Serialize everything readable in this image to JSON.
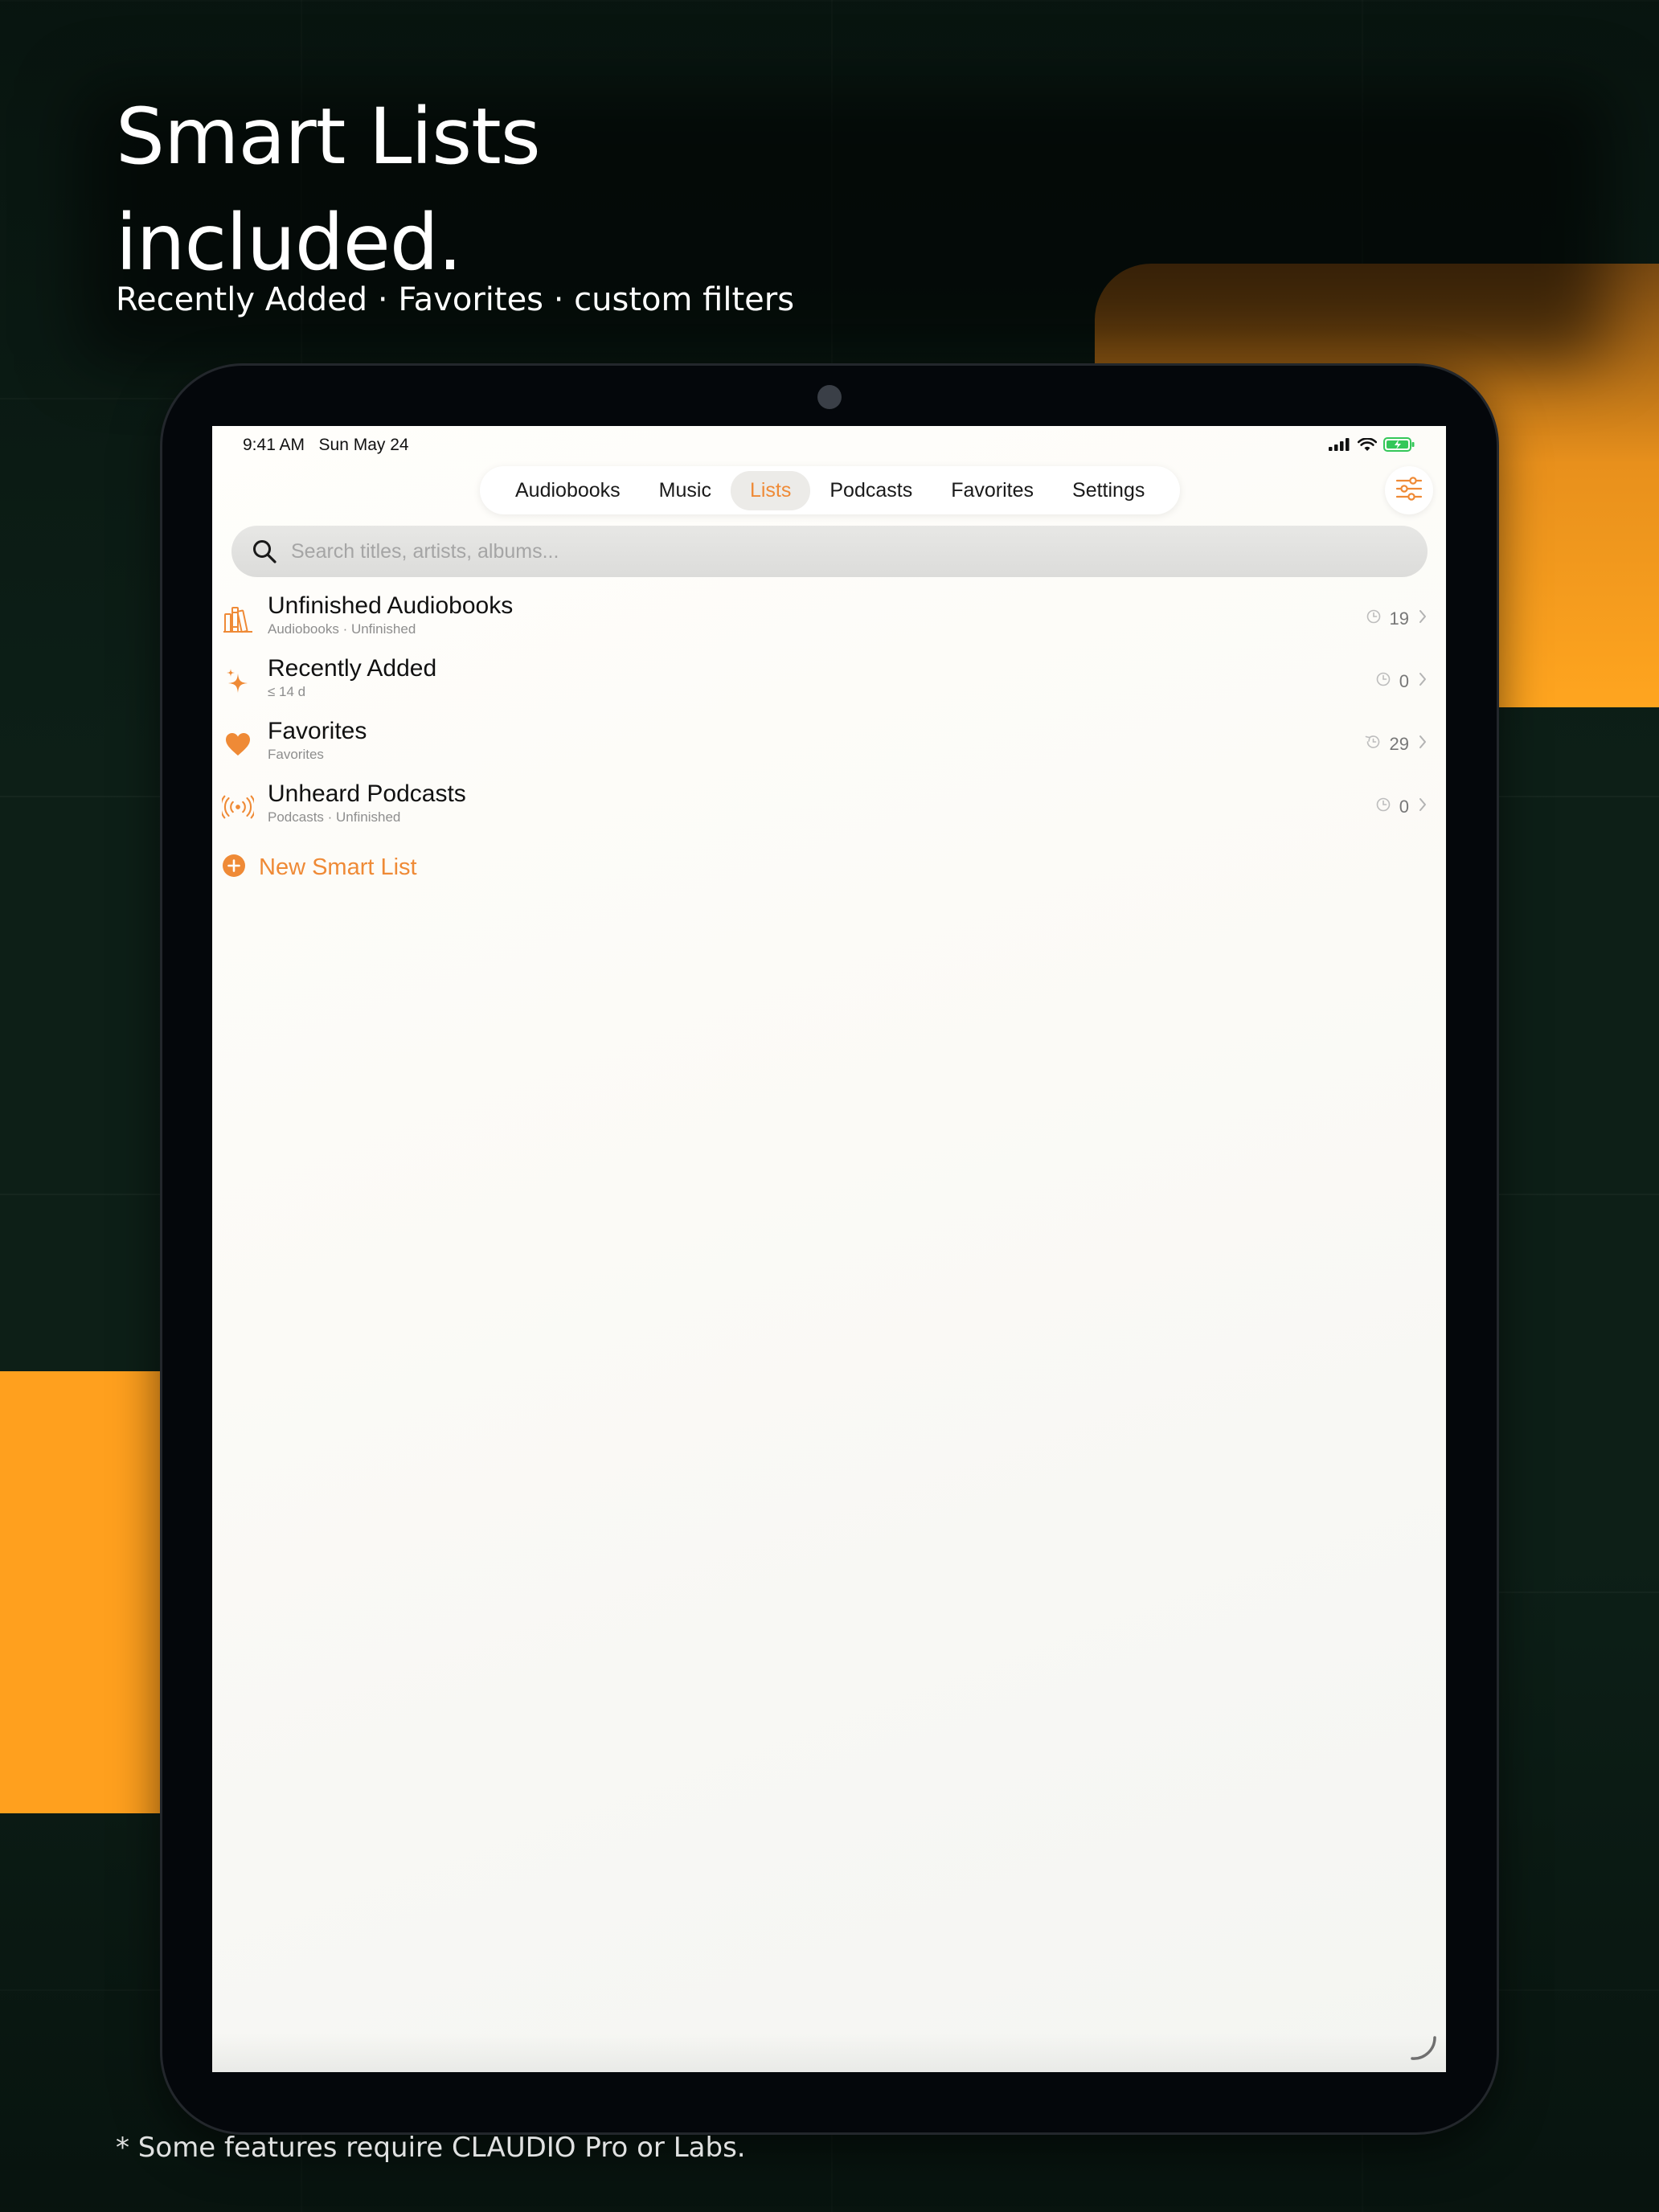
{
  "headline": {
    "line1": "Smart Lists",
    "line2": "included.",
    "subtitle": "Recently Added · Favorites · custom filters"
  },
  "footnote": "* Some features require CLAUDIO Pro or Labs.",
  "status_bar": {
    "time_date": "9:41 AM   Sun May 24"
  },
  "tabs": [
    {
      "label": "Audiobooks",
      "active": false
    },
    {
      "label": "Music",
      "active": false
    },
    {
      "label": "Lists",
      "active": true
    },
    {
      "label": "Podcasts",
      "active": false
    },
    {
      "label": "Favorites",
      "active": false
    },
    {
      "label": "Settings",
      "active": false
    }
  ],
  "search": {
    "placeholder": "Search titles, artists, albums..."
  },
  "lists": [
    {
      "title": "Unfinished Audiobooks",
      "subtitle": "Audiobooks · Unfinished",
      "count": "19",
      "icon": "books-icon",
      "meta_icon": "clock-icon"
    },
    {
      "title": "Recently Added",
      "subtitle": "≤ 14 d",
      "count": "0",
      "icon": "sparkles-icon",
      "meta_icon": "clock-icon"
    },
    {
      "title": "Favorites",
      "subtitle": "Favorites",
      "count": "29",
      "icon": "heart-icon",
      "meta_icon": "history-icon"
    },
    {
      "title": "Unheard Podcasts",
      "subtitle": "Podcasts · Unfinished",
      "count": "0",
      "icon": "broadcast-icon",
      "meta_icon": "clock-icon"
    }
  ],
  "new_list_label": "New Smart List",
  "colors": {
    "accent": "#ef8a36",
    "background": "#0d1f17",
    "highlight_orange": "#ffa01e"
  }
}
